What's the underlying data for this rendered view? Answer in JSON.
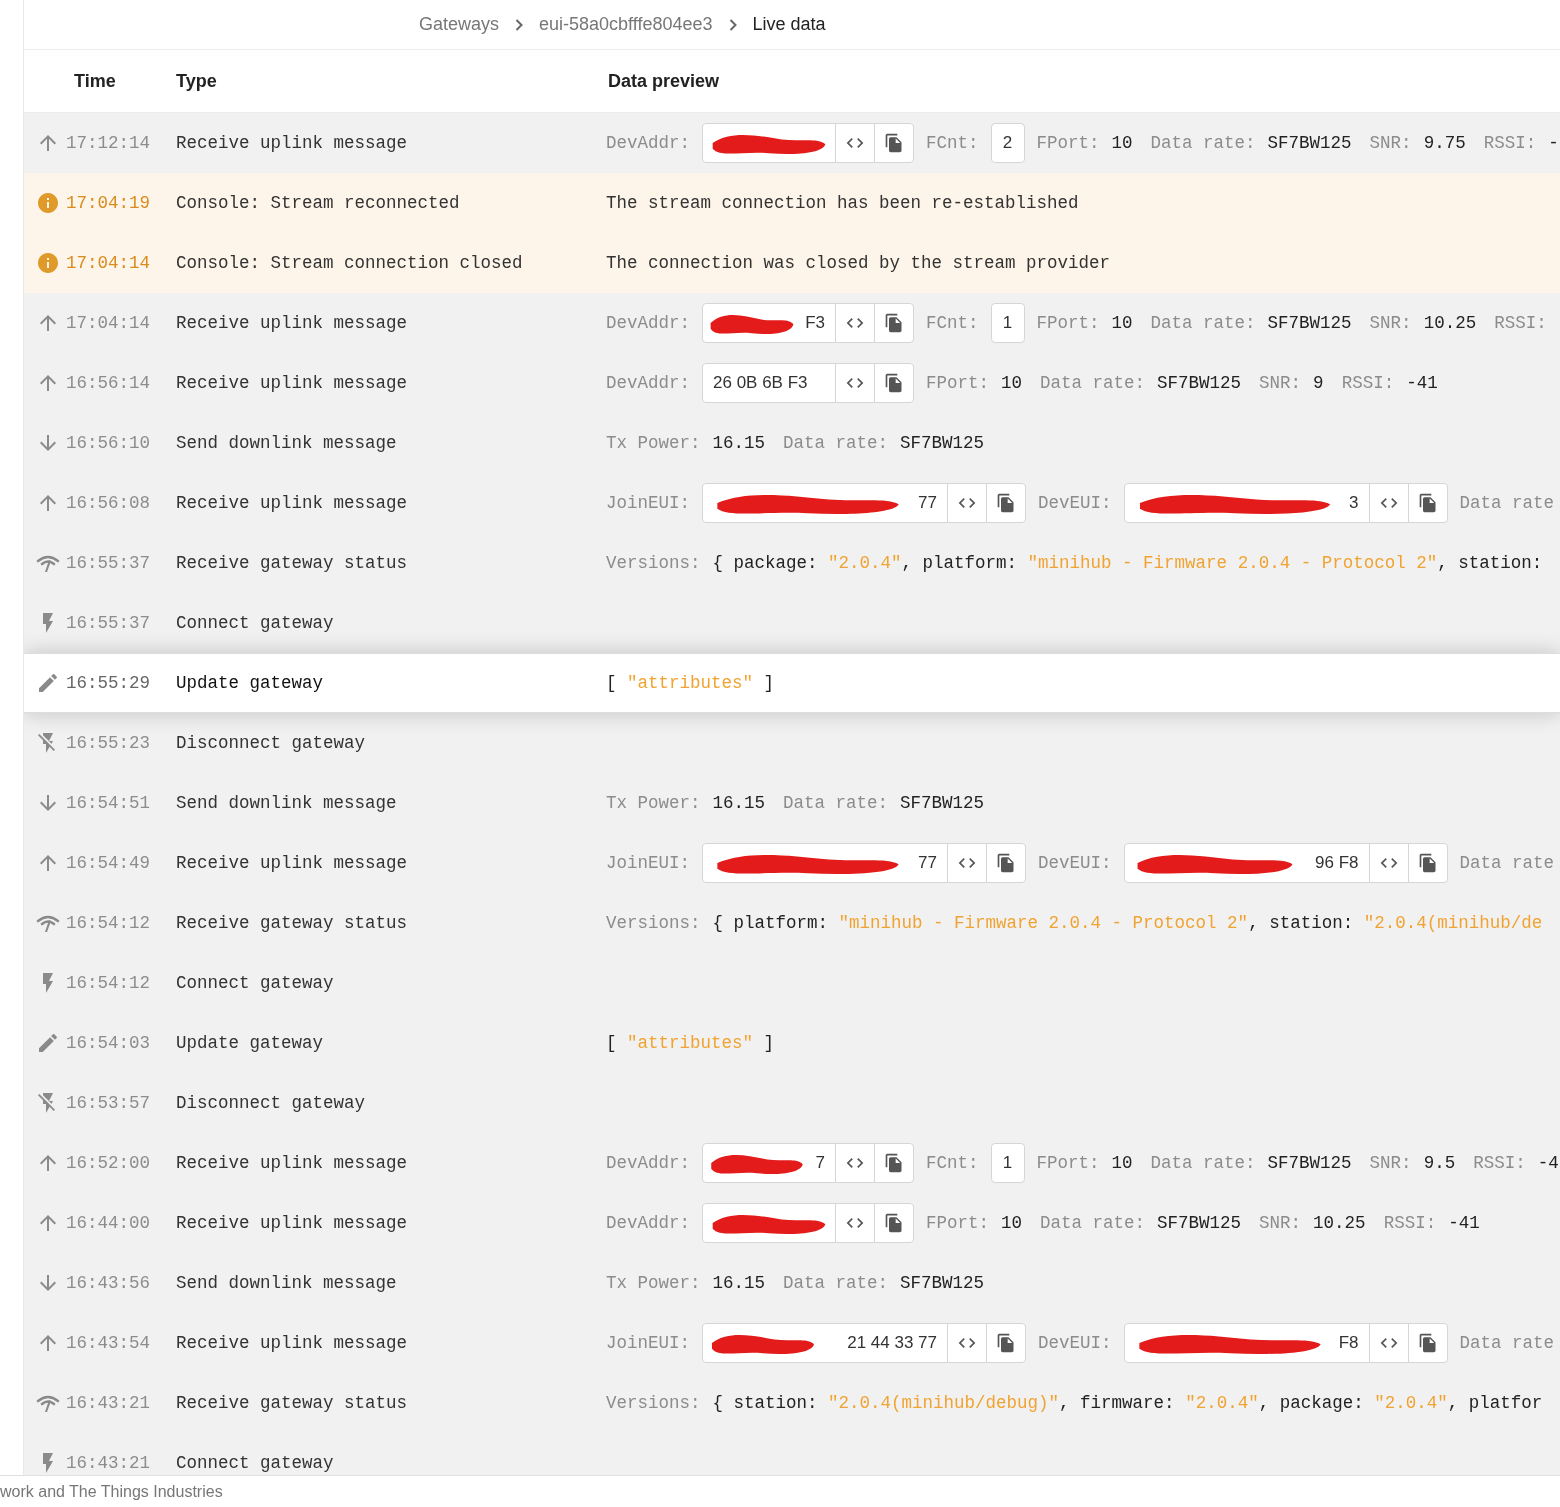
{
  "breadcrumb": [
    {
      "text": "Gateways",
      "current": false
    },
    {
      "text": "eui-58a0cbfffe804ee3",
      "current": false
    },
    {
      "text": "Live data",
      "current": true
    }
  ],
  "table": {
    "columns": [
      "Time",
      "Type",
      "Data preview"
    ],
    "rows": [
      {
        "kind": "uplink",
        "selected": false,
        "time": "17:12:14",
        "type": "Receive uplink message",
        "preview": [
          {
            "kind": "label",
            "text": "DevAddr:"
          },
          {
            "kind": "devaddr-field",
            "redacted": true
          },
          {
            "kind": "label",
            "text": "FCnt:"
          },
          {
            "kind": "count",
            "text": "2"
          },
          {
            "kind": "label",
            "text": "FPort:"
          },
          {
            "kind": "value",
            "text": "10"
          },
          {
            "kind": "label",
            "text": "Data rate:"
          },
          {
            "kind": "value",
            "text": "SF7BW125"
          },
          {
            "kind": "label",
            "text": "SNR:"
          },
          {
            "kind": "value",
            "text": "9.75"
          },
          {
            "kind": "label",
            "text": "RSSI:"
          },
          {
            "kind": "value",
            "text": "-"
          }
        ]
      },
      {
        "kind": "info",
        "selected": false,
        "time": "17:04:19",
        "type": "Console: Stream reconnected",
        "preview": [
          {
            "kind": "message",
            "text": "The stream connection has been re-established"
          }
        ]
      },
      {
        "kind": "info",
        "selected": false,
        "time": "17:04:14",
        "type": "Console: Stream connection closed",
        "preview": [
          {
            "kind": "message",
            "text": "The connection was closed by the stream provider"
          }
        ]
      },
      {
        "kind": "uplink",
        "selected": false,
        "time": "17:04:14",
        "type": "Receive uplink message",
        "preview": [
          {
            "kind": "label",
            "text": "DevAddr:"
          },
          {
            "kind": "devaddr-field",
            "redacted": true,
            "value": "F3"
          },
          {
            "kind": "label",
            "text": "FCnt:"
          },
          {
            "kind": "count",
            "text": "1"
          },
          {
            "kind": "label",
            "text": "FPort:"
          },
          {
            "kind": "value",
            "text": "10"
          },
          {
            "kind": "label",
            "text": "Data rate:"
          },
          {
            "kind": "value",
            "text": "SF7BW125"
          },
          {
            "kind": "label",
            "text": "SNR:"
          },
          {
            "kind": "value",
            "text": "10.25"
          },
          {
            "kind": "label",
            "text": "RSSI:"
          }
        ]
      },
      {
        "kind": "uplink",
        "selected": false,
        "time": "16:56:14",
        "type": "Receive uplink message",
        "preview": [
          {
            "kind": "label",
            "text": "DevAddr:"
          },
          {
            "kind": "devaddr-field",
            "redacted": false,
            "value": "26 0B 6B F3"
          },
          {
            "kind": "label",
            "text": "FPort:"
          },
          {
            "kind": "value",
            "text": "10"
          },
          {
            "kind": "label",
            "text": "Data rate:"
          },
          {
            "kind": "value",
            "text": "SF7BW125"
          },
          {
            "kind": "label",
            "text": "SNR:"
          },
          {
            "kind": "value",
            "text": "9"
          },
          {
            "kind": "label",
            "text": "RSSI:"
          },
          {
            "kind": "value",
            "text": "-41"
          }
        ]
      },
      {
        "kind": "downlink",
        "selected": false,
        "time": "16:56:10",
        "type": "Send downlink message",
        "preview": [
          {
            "kind": "label",
            "text": "Tx Power:"
          },
          {
            "kind": "value",
            "text": "16.15"
          },
          {
            "kind": "label",
            "text": "Data rate:"
          },
          {
            "kind": "value",
            "text": "SF7BW125"
          }
        ]
      },
      {
        "kind": "uplink",
        "selected": false,
        "time": "16:56:08",
        "type": "Receive uplink message",
        "preview": [
          {
            "kind": "label",
            "text": "JoinEUI:"
          },
          {
            "kind": "eui-field",
            "redacted": true,
            "value": "77"
          },
          {
            "kind": "label",
            "text": "DevEUI:"
          },
          {
            "kind": "eui-field",
            "redacted": true,
            "value": "3"
          },
          {
            "kind": "label",
            "text": "Data rate"
          }
        ]
      },
      {
        "kind": "status",
        "selected": false,
        "time": "16:55:37",
        "type": "Receive gateway status",
        "preview": [
          {
            "kind": "label",
            "text": "Versions:"
          },
          {
            "kind": "code",
            "parts": [
              {
                "kind": "punct",
                "text": "{ package: "
              },
              {
                "kind": "string",
                "text": "\"2.0.4\""
              },
              {
                "kind": "punct",
                "text": ", platform: "
              },
              {
                "kind": "string",
                "text": "\"minihub - Firmware 2.0.4 - Protocol 2\""
              },
              {
                "kind": "punct",
                "text": ", station:"
              }
            ]
          }
        ]
      },
      {
        "kind": "connect",
        "selected": false,
        "time": "16:55:37",
        "type": "Connect gateway",
        "preview": []
      },
      {
        "kind": "update",
        "selected": true,
        "time": "16:55:29",
        "type": "Update gateway",
        "preview": [
          {
            "kind": "code",
            "parts": [
              {
                "kind": "punct",
                "text": "[ "
              },
              {
                "kind": "string",
                "text": "\"attributes\""
              },
              {
                "kind": "punct",
                "text": " ]"
              }
            ]
          }
        ]
      },
      {
        "kind": "disconnect",
        "selected": false,
        "time": "16:55:23",
        "type": "Disconnect gateway",
        "preview": []
      },
      {
        "kind": "downlink",
        "selected": false,
        "time": "16:54:51",
        "type": "Send downlink message",
        "preview": [
          {
            "kind": "label",
            "text": "Tx Power:"
          },
          {
            "kind": "value",
            "text": "16.15"
          },
          {
            "kind": "label",
            "text": "Data rate:"
          },
          {
            "kind": "value",
            "text": "SF7BW125"
          }
        ]
      },
      {
        "kind": "uplink",
        "selected": false,
        "time": "16:54:49",
        "type": "Receive uplink message",
        "preview": [
          {
            "kind": "label",
            "text": "JoinEUI:"
          },
          {
            "kind": "eui-field",
            "redacted": true,
            "value": "77"
          },
          {
            "kind": "label",
            "text": "DevEUI:"
          },
          {
            "kind": "eui-field",
            "redacted": true,
            "value": "96 F8"
          },
          {
            "kind": "label",
            "text": "Data rate"
          }
        ]
      },
      {
        "kind": "status",
        "selected": false,
        "time": "16:54:12",
        "type": "Receive gateway status",
        "preview": [
          {
            "kind": "label",
            "text": "Versions:"
          },
          {
            "kind": "code",
            "parts": [
              {
                "kind": "punct",
                "text": "{ platform: "
              },
              {
                "kind": "string",
                "text": "\"minihub - Firmware 2.0.4 - Protocol 2\""
              },
              {
                "kind": "punct",
                "text": ", station: "
              },
              {
                "kind": "string",
                "text": "\"2.0.4(minihub/de"
              }
            ]
          }
        ]
      },
      {
        "kind": "connect",
        "selected": false,
        "time": "16:54:12",
        "type": "Connect gateway",
        "preview": []
      },
      {
        "kind": "update",
        "selected": false,
        "time": "16:54:03",
        "type": "Update gateway",
        "preview": [
          {
            "kind": "code",
            "parts": [
              {
                "kind": "punct",
                "text": "[ "
              },
              {
                "kind": "string",
                "text": "\"attributes\""
              },
              {
                "kind": "punct",
                "text": " ]"
              }
            ]
          }
        ]
      },
      {
        "kind": "disconnect",
        "selected": false,
        "time": "16:53:57",
        "type": "Disconnect gateway",
        "preview": []
      },
      {
        "kind": "uplink",
        "selected": false,
        "time": "16:52:00",
        "type": "Receive uplink message",
        "preview": [
          {
            "kind": "label",
            "text": "DevAddr:"
          },
          {
            "kind": "devaddr-field",
            "redacted": true,
            "value": "7"
          },
          {
            "kind": "label",
            "text": "FCnt:"
          },
          {
            "kind": "count",
            "text": "1"
          },
          {
            "kind": "label",
            "text": "FPort:"
          },
          {
            "kind": "value",
            "text": "10"
          },
          {
            "kind": "label",
            "text": "Data rate:"
          },
          {
            "kind": "value",
            "text": "SF7BW125"
          },
          {
            "kind": "label",
            "text": "SNR:"
          },
          {
            "kind": "value",
            "text": "9.5"
          },
          {
            "kind": "label",
            "text": "RSSI:"
          },
          {
            "kind": "value",
            "text": "-4"
          }
        ]
      },
      {
        "kind": "uplink",
        "selected": false,
        "time": "16:44:00",
        "type": "Receive uplink message",
        "preview": [
          {
            "kind": "label",
            "text": "DevAddr:"
          },
          {
            "kind": "devaddr-field",
            "redacted": true
          },
          {
            "kind": "label",
            "text": "FPort:"
          },
          {
            "kind": "value",
            "text": "10"
          },
          {
            "kind": "label",
            "text": "Data rate:"
          },
          {
            "kind": "value",
            "text": "SF7BW125"
          },
          {
            "kind": "label",
            "text": "SNR:"
          },
          {
            "kind": "value",
            "text": "10.25"
          },
          {
            "kind": "label",
            "text": "RSSI:"
          },
          {
            "kind": "value",
            "text": "-41"
          }
        ]
      },
      {
        "kind": "downlink",
        "selected": false,
        "time": "16:43:56",
        "type": "Send downlink message",
        "preview": [
          {
            "kind": "label",
            "text": "Tx Power:"
          },
          {
            "kind": "value",
            "text": "16.15"
          },
          {
            "kind": "label",
            "text": "Data rate:"
          },
          {
            "kind": "value",
            "text": "SF7BW125"
          }
        ]
      },
      {
        "kind": "uplink",
        "selected": false,
        "time": "16:43:54",
        "type": "Receive uplink message",
        "preview": [
          {
            "kind": "label",
            "text": "JoinEUI:"
          },
          {
            "kind": "eui-field",
            "redacted": true,
            "value": "21 44 33 77"
          },
          {
            "kind": "label",
            "text": "DevEUI:"
          },
          {
            "kind": "eui-field",
            "redacted": true,
            "value": "F8"
          },
          {
            "kind": "label",
            "text": "Data rate"
          }
        ]
      },
      {
        "kind": "status",
        "selected": false,
        "time": "16:43:21",
        "type": "Receive gateway status",
        "preview": [
          {
            "kind": "label",
            "text": "Versions:"
          },
          {
            "kind": "code",
            "parts": [
              {
                "kind": "punct",
                "text": "{ station: "
              },
              {
                "kind": "string",
                "text": "\"2.0.4(minihub/debug)\""
              },
              {
                "kind": "punct",
                "text": ", firmware: "
              },
              {
                "kind": "string",
                "text": "\"2.0.4\""
              },
              {
                "kind": "punct",
                "text": ", package: "
              },
              {
                "kind": "string",
                "text": "\"2.0.4\""
              },
              {
                "kind": "punct",
                "text": ", platfor"
              }
            ]
          }
        ]
      },
      {
        "kind": "connect",
        "selected": false,
        "time": "16:43:21",
        "type": "Connect gateway",
        "preview": []
      }
    ]
  },
  "footer": {
    "text": "work and The Things Industries"
  }
}
